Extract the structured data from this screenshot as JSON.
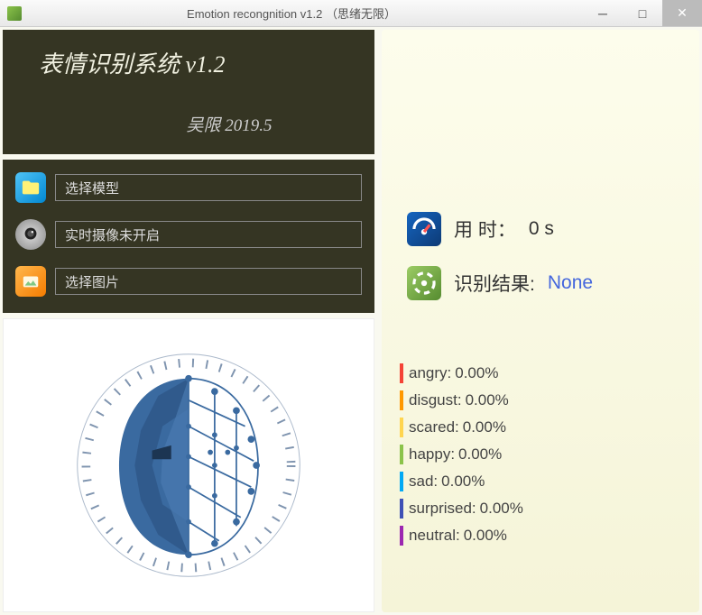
{
  "window": {
    "title": "Emotion recongnition v1.2 （思绪无限）"
  },
  "header": {
    "title": "表情识别系统  v1.2",
    "author": "吴限  2019.5"
  },
  "options": {
    "model_label": "选择模型",
    "camera_label": "实时摄像未开启",
    "image_label": "选择图片"
  },
  "info": {
    "timing_label": "用 时：",
    "timing_value": "0 s",
    "result_label": "识别结果:",
    "result_value": "None"
  },
  "emotions": [
    {
      "name": "angry",
      "pct": "0.00%",
      "color": "#f44336"
    },
    {
      "name": "disgust",
      "pct": "0.00%",
      "color": "#ff9800"
    },
    {
      "name": "scared",
      "pct": "0.00%",
      "color": "#ffd54f"
    },
    {
      "name": "happy",
      "pct": "0.00%",
      "color": "#8bc34a"
    },
    {
      "name": "sad",
      "pct": "0.00%",
      "color": "#03a9f4"
    },
    {
      "name": "surprised",
      "pct": "0.00%",
      "color": "#3f51b5"
    },
    {
      "name": "neutral",
      "pct": "0.00%",
      "color": "#9c27b0"
    }
  ]
}
